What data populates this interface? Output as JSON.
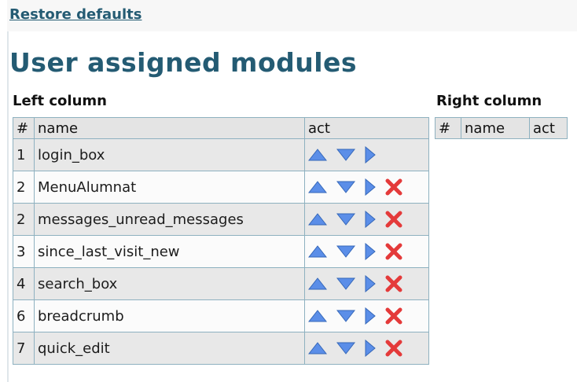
{
  "restore": {
    "label": "Restore defaults"
  },
  "title": "User assigned modules",
  "left_column": {
    "label": "Left column",
    "headers": [
      "#",
      "name",
      "act"
    ],
    "rows": [
      {
        "num": "1",
        "name": "login_box",
        "actions": [
          "up",
          "down",
          "right"
        ]
      },
      {
        "num": "2",
        "name": "MenuAlumnat",
        "actions": [
          "up",
          "down",
          "right",
          "delete"
        ]
      },
      {
        "num": "2",
        "name": "messages_unread_messages",
        "actions": [
          "up",
          "down",
          "right",
          "delete"
        ]
      },
      {
        "num": "3",
        "name": "since_last_visit_new",
        "actions": [
          "up",
          "down",
          "right",
          "delete"
        ]
      },
      {
        "num": "4",
        "name": "search_box",
        "actions": [
          "up",
          "down",
          "right",
          "delete"
        ]
      },
      {
        "num": "6",
        "name": "breadcrumb",
        "actions": [
          "up",
          "down",
          "right",
          "delete"
        ]
      },
      {
        "num": "7",
        "name": "quick_edit",
        "actions": [
          "up",
          "down",
          "right",
          "delete"
        ]
      }
    ]
  },
  "right_column": {
    "label": "Right column",
    "headers": [
      "#",
      "name",
      "act"
    ]
  },
  "colors": {
    "link": "#245b73",
    "table_border": "#8eb1c0",
    "row_alt": "#e8e8e8",
    "row": "#fbfbfb",
    "arrow_blue": "#5b8ee8",
    "delete_red": "#e43a3a"
  }
}
